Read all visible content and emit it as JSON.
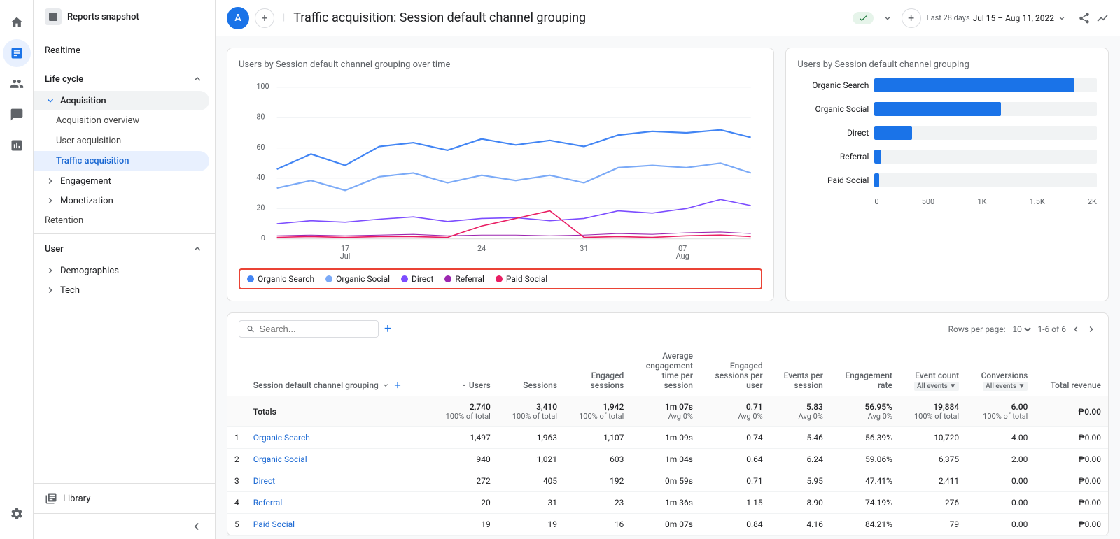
{
  "app": {
    "nav_snapshot": "Reports snapshot",
    "nav_realtime": "Realtime"
  },
  "sidebar_icons": [
    "home",
    "analytics",
    "audience",
    "marketing",
    "report",
    "settings"
  ],
  "lifecycle": {
    "label": "Life cycle",
    "sections": [
      {
        "label": "Acquisition",
        "expanded": true,
        "items": [
          "Acquisition overview",
          "User acquisition",
          "Traffic acquisition"
        ]
      },
      {
        "label": "Engagement",
        "expanded": false,
        "items": []
      },
      {
        "label": "Monetization",
        "expanded": false,
        "items": []
      },
      {
        "label": "Retention",
        "expanded": false,
        "items": []
      }
    ]
  },
  "user_section": {
    "label": "User",
    "sections": [
      {
        "label": "Demographics",
        "expanded": false
      },
      {
        "label": "Tech",
        "expanded": false
      }
    ]
  },
  "library": "Library",
  "collapse_label": "Collapse",
  "topbar": {
    "title": "Traffic acquisition: Session default channel grouping",
    "status": "●",
    "date_prefix": "Last 28 days",
    "date_range": "Jul 15 – Aug 11, 2022"
  },
  "line_chart": {
    "title": "Users by Session default channel grouping over time",
    "y_labels": [
      "100",
      "80",
      "60",
      "40",
      "20",
      "0"
    ],
    "x_labels": [
      "17",
      "24",
      "31",
      "07"
    ],
    "x_sublabels": [
      "Jul",
      "",
      "",
      "Aug"
    ],
    "legend": [
      {
        "label": "Organic Search",
        "color": "#4285f4"
      },
      {
        "label": "Organic Social",
        "color": "#4285f4"
      },
      {
        "label": "Direct",
        "color": "#7c4dff"
      },
      {
        "label": "Referral",
        "color": "#7c4dff"
      },
      {
        "label": "Paid Social",
        "color": "#e91e63"
      }
    ]
  },
  "bar_chart": {
    "title": "Users by Session default channel grouping",
    "bars": [
      {
        "label": "Organic Search",
        "value": 1497,
        "max": 2000,
        "pct": 90
      },
      {
        "label": "Organic Social",
        "value": 940,
        "max": 2000,
        "pct": 57
      },
      {
        "label": "Direct",
        "value": 272,
        "max": 2000,
        "pct": 17
      },
      {
        "label": "Referral",
        "value": 20,
        "max": 2000,
        "pct": 3
      },
      {
        "label": "Paid Social",
        "value": 19,
        "max": 2000,
        "pct": 2
      }
    ],
    "x_axis": [
      "0",
      "500",
      "1K",
      "1.5K",
      "2K"
    ]
  },
  "table": {
    "search_placeholder": "Search...",
    "rows_per_page_label": "Rows per page:",
    "rows_per_page_value": "10",
    "pagination": "1-6 of 6",
    "col_header": "Session default channel grouping",
    "columns": [
      "Users",
      "Sessions",
      "Engaged sessions",
      "Average engagement time per session",
      "Engaged sessions per user",
      "Events per session",
      "Engagement rate",
      "Event count",
      "Conversions",
      "Total revenue"
    ],
    "col_sub": [
      "",
      "",
      "",
      "",
      "",
      "",
      "",
      "All events ▼",
      "All events ▼",
      ""
    ],
    "totals": {
      "label": "Totals",
      "users": "2,740",
      "users_sub": "100% of total",
      "sessions": "3,410",
      "sessions_sub": "100% of total",
      "engaged": "1,942",
      "engaged_sub": "100% of total",
      "avg_time": "1m 07s",
      "avg_time_sub": "Avg 0%",
      "eng_per_user": "0.71",
      "eng_per_user_sub": "Avg 0%",
      "events_per": "5.83",
      "events_per_sub": "Avg 0%",
      "eng_rate": "56.95%",
      "eng_rate_sub": "Avg 0%",
      "event_count": "19,884",
      "event_count_sub": "100% of total",
      "conversions": "6.00",
      "conversions_sub": "100% of total",
      "revenue": "₱0.00"
    },
    "rows": [
      {
        "rank": "1",
        "channel": "Organic Search",
        "users": "1,497",
        "sessions": "1,963",
        "engaged": "1,107",
        "avg_time": "1m 09s",
        "eng_per_user": "0.74",
        "events_per": "5.46",
        "eng_rate": "56.39%",
        "event_count": "10,720",
        "conversions": "4.00",
        "revenue": "₱0.00"
      },
      {
        "rank": "2",
        "channel": "Organic Social",
        "users": "940",
        "sessions": "1,021",
        "engaged": "603",
        "avg_time": "1m 04s",
        "eng_per_user": "0.64",
        "events_per": "6.24",
        "eng_rate": "59.06%",
        "event_count": "6,375",
        "conversions": "2.00",
        "revenue": "₱0.00"
      },
      {
        "rank": "3",
        "channel": "Direct",
        "users": "272",
        "sessions": "405",
        "engaged": "192",
        "avg_time": "0m 59s",
        "eng_per_user": "0.71",
        "events_per": "5.95",
        "eng_rate": "47.41%",
        "event_count": "2,411",
        "conversions": "0.00",
        "revenue": "₱0.00"
      },
      {
        "rank": "4",
        "channel": "Referral",
        "users": "20",
        "sessions": "31",
        "engaged": "23",
        "avg_time": "1m 36s",
        "eng_per_user": "1.15",
        "events_per": "8.90",
        "eng_rate": "74.19%",
        "event_count": "276",
        "conversions": "0.00",
        "revenue": "₱0.00"
      },
      {
        "rank": "5",
        "channel": "Paid Social",
        "users": "19",
        "sessions": "19",
        "engaged": "16",
        "avg_time": "0m 07s",
        "eng_per_user": "0.84",
        "events_per": "4.16",
        "eng_rate": "84.21%",
        "event_count": "79",
        "conversions": "0.00",
        "revenue": "₱0.00"
      }
    ]
  }
}
